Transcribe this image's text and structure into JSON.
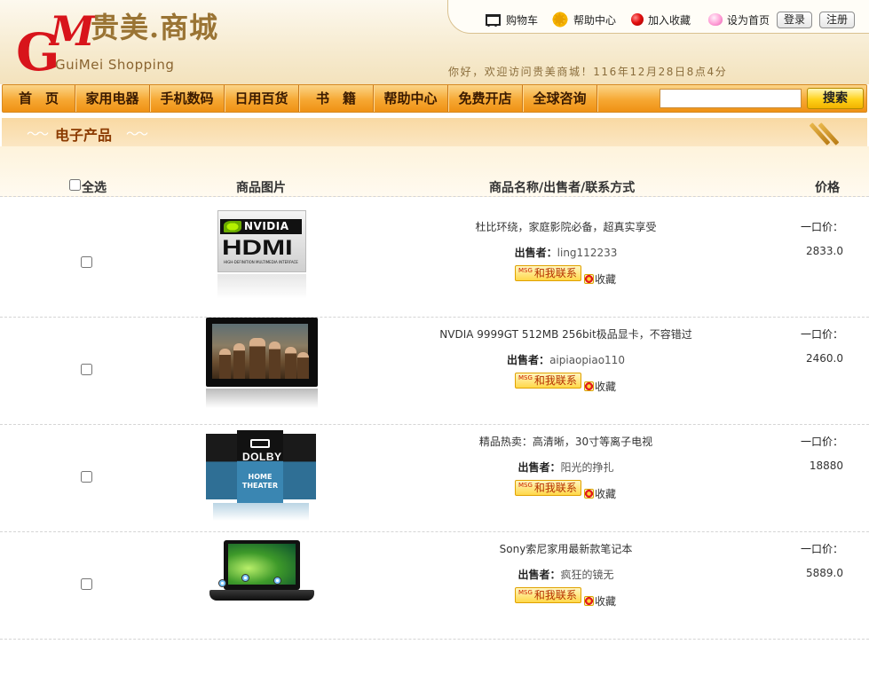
{
  "site": {
    "logo_letters": "GM",
    "logo_cn": "贵美.商城",
    "logo_en": "GuiMei Shopping",
    "welcome": "你好，欢迎访问贵美商城！116年12月28日8点4分"
  },
  "toplinks": {
    "cart": "购物车",
    "help": "帮助中心",
    "favorite": "加入收藏",
    "homepage": "设为首页",
    "login": "登录",
    "register": "注册"
  },
  "nav": {
    "items": [
      "首　页",
      "家用电器",
      "手机数码",
      "日用百货",
      "书　籍",
      "帮助中心",
      "免费开店",
      "全球咨询"
    ],
    "search_value": "",
    "search_button": "搜索"
  },
  "section": {
    "title": "电子产品"
  },
  "table": {
    "headers": {
      "select_all": "全选",
      "picture": "商品图片",
      "info": "商品名称/出售者/联系方式",
      "price": "价格"
    },
    "seller_label": "出售者：",
    "contact_label": "和我联系",
    "contact_badge": "MSG",
    "favorite_label": "收藏",
    "price_label": "一口价：",
    "rows": [
      {
        "name": "杜比环绕，家庭影院必备，超真实享受",
        "seller": "ling112233",
        "price": "2833.0",
        "image": "nvidia-hdmi-image"
      },
      {
        "name": "NVDIA 9999GT 512MB 256bit极品显卡，不容错过",
        "seller": "aipiaopiao110",
        "price": "2460.0",
        "image": "tv-image"
      },
      {
        "name": "精品热卖：高清晰，30寸等离子电视",
        "seller": "阳光的挣扎",
        "price": "18880",
        "image": "dolby-home-theater-image"
      },
      {
        "name": "Sony索尼家用最新款笔记本",
        "seller": "疯狂的镜无",
        "price": "5889.0",
        "image": "laptop-image"
      }
    ]
  },
  "image_text": {
    "nvidia": "NVIDIA",
    "hdmi": "HDMI",
    "hdmi_sub": "HIGH-DEFINITION MULTIMEDIA INTERFACE",
    "dolby": "DOLBY",
    "home_theater": "HOME THEATER"
  }
}
